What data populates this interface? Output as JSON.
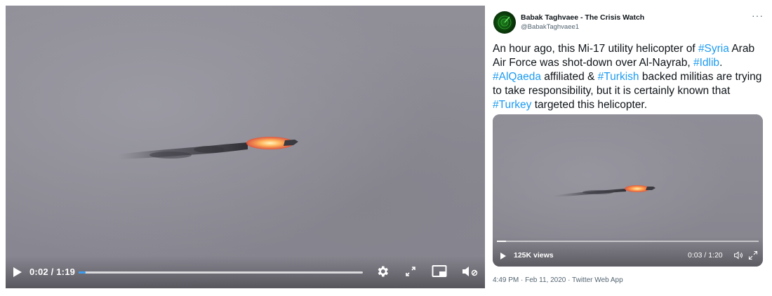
{
  "left_player": {
    "time_display": "0:02 / 1:19",
    "progress_fraction": 0.025
  },
  "tweet": {
    "author_name": "Babak Taghvaee - The Crisis Watch",
    "author_handle": "@BabakTaghvaee1",
    "more_icon": "···",
    "text": [
      {
        "type": "text",
        "value": "An hour ago, this Mi-17 utility helicopter of "
      },
      {
        "type": "hashtag",
        "value": "#Syria"
      },
      {
        "type": "text",
        "value": " Arab Air Force was shot-down over Al-Nayrab, "
      },
      {
        "type": "hashtag",
        "value": "#Idlib"
      },
      {
        "type": "text",
        "value": ". "
      },
      {
        "type": "hashtag",
        "value": "#AlQaeda"
      },
      {
        "type": "text",
        "value": " affiliated & "
      },
      {
        "type": "hashtag",
        "value": "#Turkish"
      },
      {
        "type": "text",
        "value": " backed militias are trying to take responsibility, but it is certainly known that "
      },
      {
        "type": "hashtag",
        "value": "#Turkey"
      },
      {
        "type": "text",
        "value": " targeted this helicopter."
      }
    ],
    "video": {
      "views": "125K views",
      "time_display": "0:03 / 1:20",
      "progress_fraction": 0.035
    },
    "timestamp": "4:49 PM · Feb 11, 2020",
    "separator": " · ",
    "client": "Twitter Web App"
  },
  "colors": {
    "hashtag": "#1d9bf0",
    "left_progress": "#3b9cf0",
    "text": "#0f1419",
    "secondary": "#536471"
  },
  "icons": [
    "play-icon",
    "gear-icon",
    "fullscreen-icon",
    "pip-icon",
    "volume-muted-icon",
    "more-icon",
    "volume-icon"
  ]
}
